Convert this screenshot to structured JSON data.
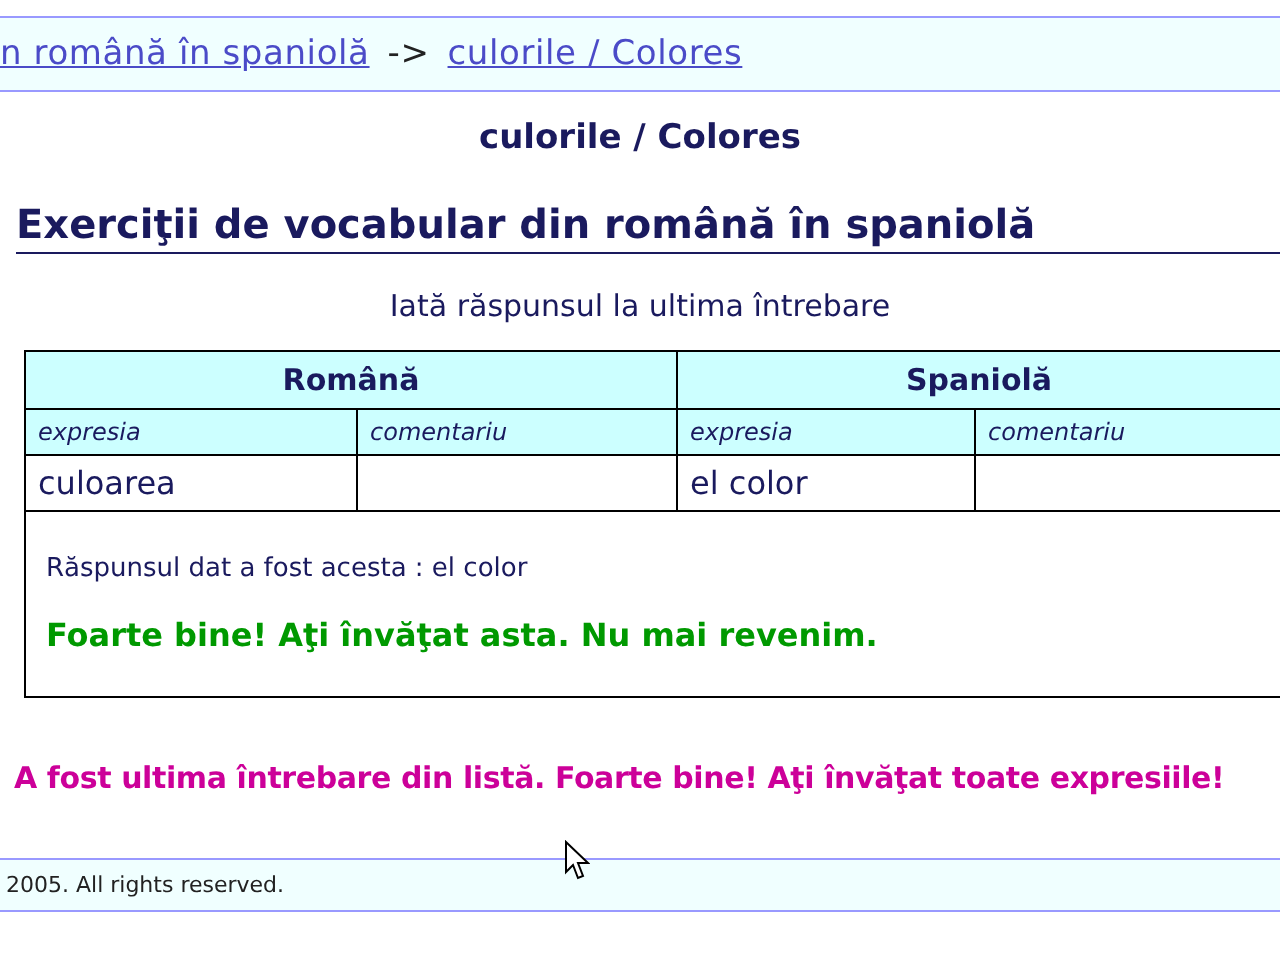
{
  "breadcrumb": {
    "links": [
      "n română în spaniolă",
      "culorile / Colores"
    ],
    "separator": "->"
  },
  "lesson_title": "culorile / Colores",
  "heading": "Exerciţii de vocabular din română în spaniolă",
  "intro": "Iată răspunsul la ultima întrebare",
  "table": {
    "groups": [
      "Română",
      "Spaniolă"
    ],
    "columns": [
      "expresia",
      "comentariu",
      "expresia",
      "comentariu"
    ],
    "rows": [
      {
        "romanian": "culoarea",
        "spanish": "el color"
      }
    ],
    "answer_given": "Răspunsul dat a fost acesta : el color",
    "feedback": "Foarte bine! Aţi învăţat asta. Nu mai revenim."
  },
  "final_message": "A fost ultima întrebare din listă. Foarte bine! Aţi învăţat toate expresiile!",
  "footer": "2005. All rights reserved."
}
